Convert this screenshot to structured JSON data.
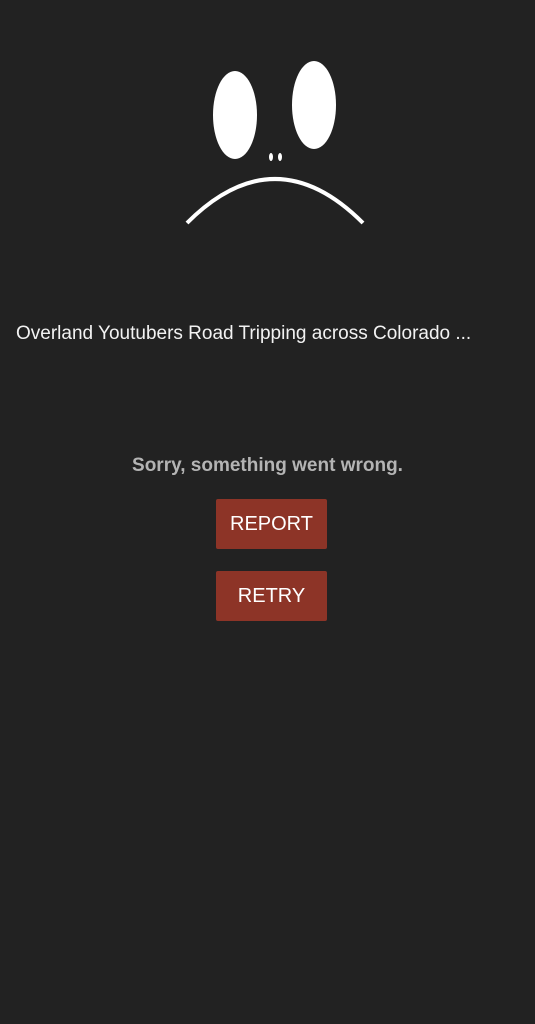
{
  "video": {
    "title": "Overland Youtubers Road Tripping across Colorado ..."
  },
  "error": {
    "message": "Sorry, something went wrong.",
    "icon": "sad-face-icon"
  },
  "actions": {
    "report_label": "REPORT",
    "retry_label": "RETRY"
  },
  "colors": {
    "background": "#222222",
    "button": "#8d3427",
    "title_text": "#f2f2f2",
    "message_text": "#b4b4b4"
  }
}
